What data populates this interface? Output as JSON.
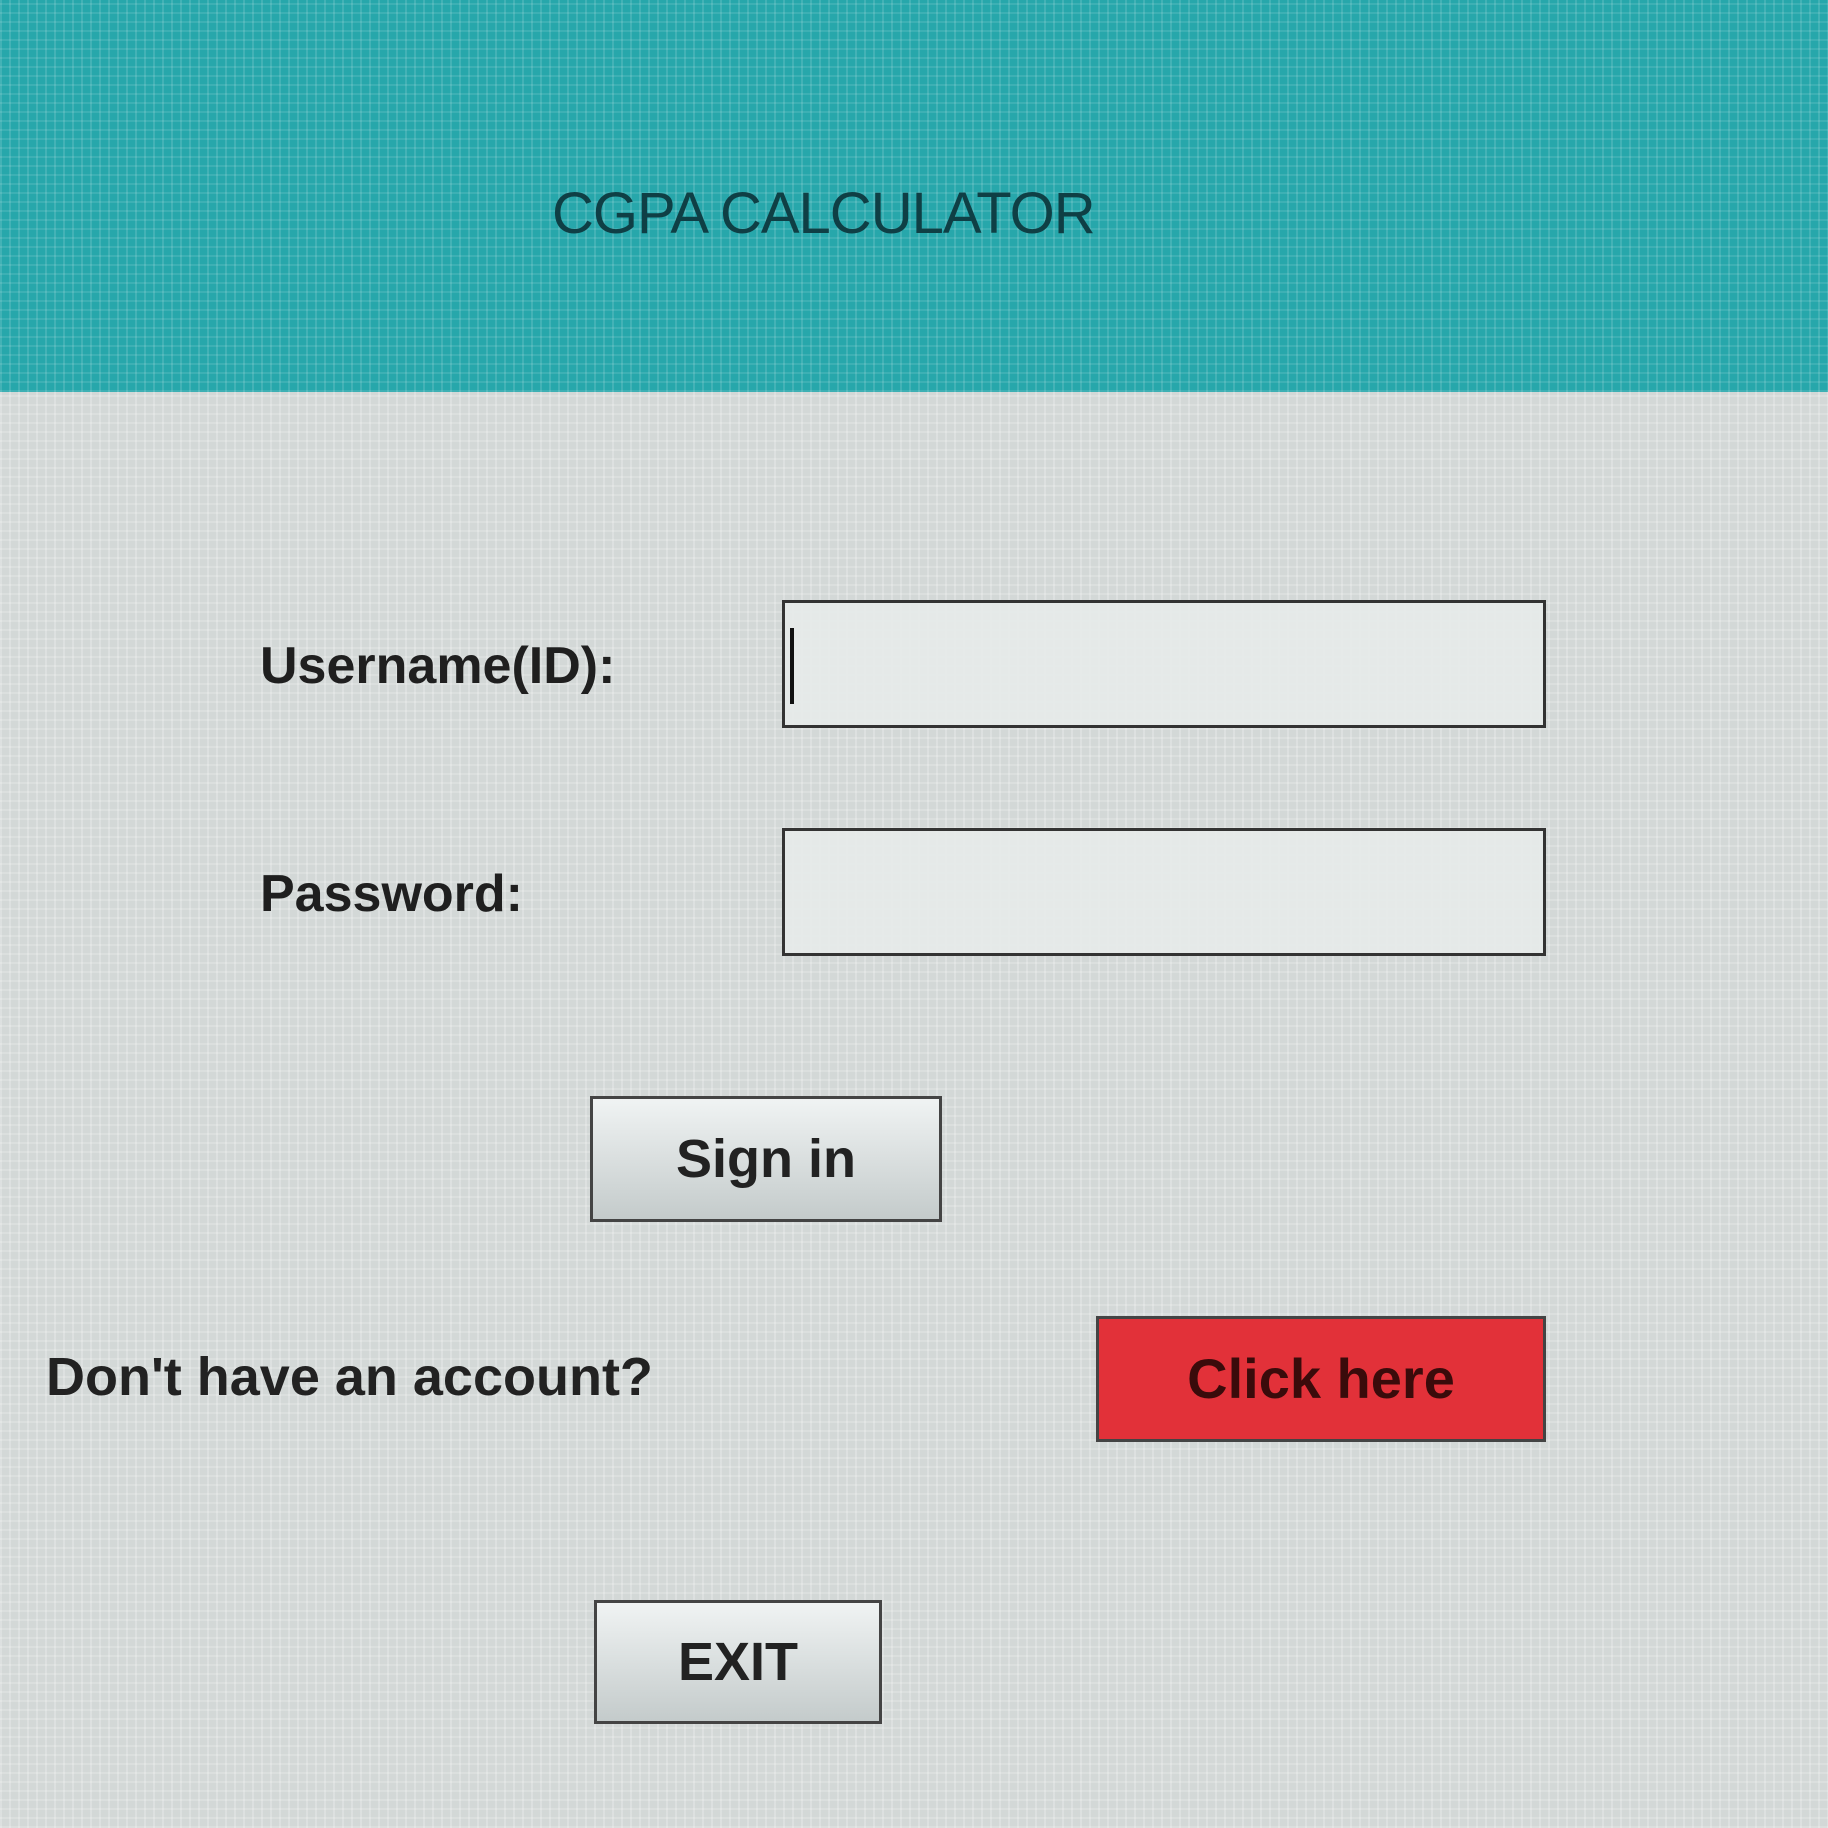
{
  "header": {
    "title": "CGPA CALCULATOR",
    "color": "#27a7ab"
  },
  "form": {
    "username_label": "Username(ID):",
    "username_value": "",
    "password_label": "Password:",
    "password_value": ""
  },
  "buttons": {
    "sign_in": "Sign in",
    "click_here": "Click here",
    "click_here_color": "#e23139",
    "exit": "EXIT"
  },
  "account": {
    "prompt": "Don't have an account?"
  }
}
